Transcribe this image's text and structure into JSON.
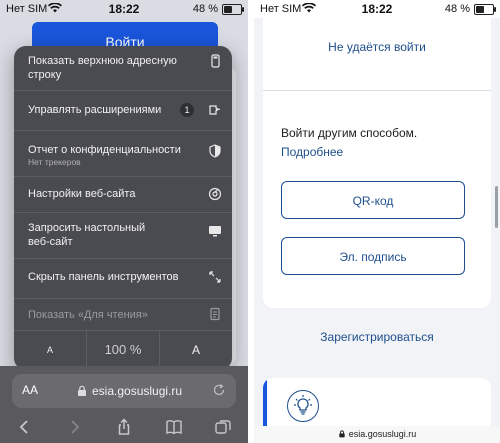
{
  "left": {
    "status": {
      "carrier": "Нет SIM",
      "time": "18:22",
      "battery": "48 %",
      "battery_level": 0.48
    },
    "login_button": "Войти",
    "menu": {
      "items": [
        {
          "label": "Показать верхнюю адресную строку",
          "icon": "phone-icon"
        },
        {
          "label": "Управлять расширениями",
          "badge": "1",
          "icon": "extension-icon"
        },
        {
          "label": "Отчет о конфиденциальности",
          "sub": "Нет трекеров",
          "icon": "shield-icon"
        },
        {
          "label": "Настройки веб-сайта",
          "icon": "gear-icon"
        },
        {
          "label": "Запросить настольный веб-сайт",
          "icon": "desktop-icon"
        },
        {
          "label": "Скрыть панель инструментов",
          "icon": "expand-arrows-icon"
        },
        {
          "label": "Показать «Для чтения»",
          "icon": "reader-icon",
          "disabled": true
        }
      ],
      "zoom": {
        "decrease": "A",
        "value": "100 %",
        "increase": "A"
      }
    },
    "address_bar": {
      "aa": "AA",
      "url": "esia.gosuslugi.ru"
    }
  },
  "right": {
    "status": {
      "carrier": "Нет SIM",
      "time": "18:22",
      "battery": "48 %",
      "battery_level": 0.48
    },
    "cant_login": "Не удаётся войти",
    "other_way": "Войти другим способом.",
    "more_link": "Подробнее",
    "qr_button": "QR-код",
    "signature_button": "Эл. подпись",
    "register": "Зарегистрироваться",
    "address": "esia.gosuslugi.ru"
  },
  "colors": {
    "accent": "#1a56db",
    "link": "#1e4f8c",
    "menu_bg": "#4a4b50"
  }
}
